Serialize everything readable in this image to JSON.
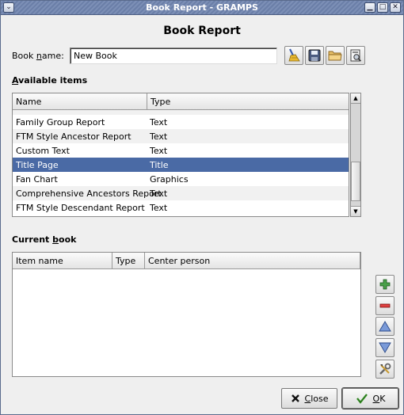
{
  "window": {
    "title": "Book Report - GRAMPS",
    "menu_glyph": "⌄",
    "min_glyph": "▁",
    "max_glyph": "□",
    "close_glyph": "✕"
  },
  "heading": "Book Report",
  "book_name": {
    "label_pre": "Book ",
    "label_mnemonic": "n",
    "label_post": "ame:",
    "value": "New Book"
  },
  "toolbar_icons": [
    "clear-book-icon",
    "save-book-icon",
    "open-book-icon",
    "edit-books-icon"
  ],
  "available": {
    "label_mnemonic": "A",
    "label_rest": "vailable items",
    "columns": [
      "Name",
      "Type"
    ],
    "rows": [
      {
        "name": "Family Group Report",
        "type": "Text"
      },
      {
        "name": "FTM Style Ancestor Report",
        "type": "Text"
      },
      {
        "name": "Custom Text",
        "type": "Text"
      },
      {
        "name": "Title Page",
        "type": "Title",
        "selected": true
      },
      {
        "name": "Fan Chart",
        "type": "Graphics"
      },
      {
        "name": "Comprehensive Ancestors Report",
        "type": "Text"
      },
      {
        "name": "FTM Style Descendant Report",
        "type": "Text"
      }
    ]
  },
  "current": {
    "label_pre": "Current ",
    "label_mnemonic": "b",
    "label_post": "ook",
    "columns": [
      "Item name",
      "Type",
      "Center person"
    ]
  },
  "side_buttons": [
    "add-icon",
    "remove-icon",
    "move-up-icon",
    "move-down-icon",
    "configure-icon"
  ],
  "buttons": {
    "close_mnemonic": "C",
    "close_rest": "lose",
    "ok_mnemonic": "O",
    "ok_rest": "K"
  },
  "colors": {
    "selection": "#4a6aa5",
    "titlebar": "#7c8fb6"
  }
}
